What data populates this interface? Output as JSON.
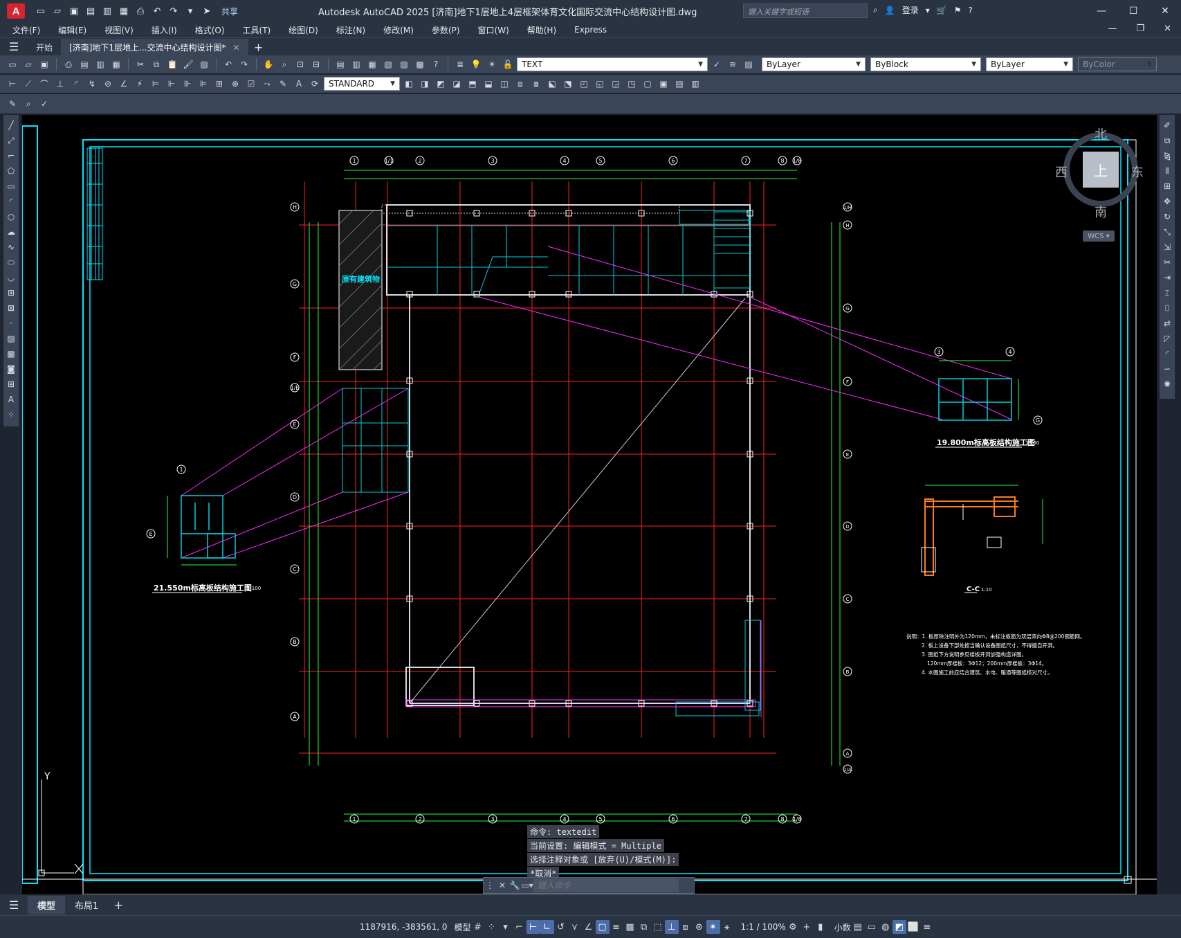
{
  "titlebar": {
    "app_letter": "A",
    "share_label": "共享",
    "title": "Autodesk AutoCAD 2025    [济南]地下1层地上4层框架体育文化国际交流中心结构设计图.dwg",
    "search_placeholder": "键入关键字或短语",
    "login_label": "登录"
  },
  "menu": {
    "items": [
      "文件(F)",
      "编辑(E)",
      "视图(V)",
      "插入(I)",
      "格式(O)",
      "工具(T)",
      "绘图(D)",
      "标注(N)",
      "修改(M)",
      "参数(P)",
      "窗口(W)",
      "帮助(H)",
      "Express"
    ]
  },
  "tabs": {
    "start_label": "开始",
    "doc_label": "[济南]地下1层地上...交流中心结构设计图*"
  },
  "toolbar": {
    "text_style": "TEXT",
    "dim_style": "STANDARD",
    "layer": "ByLayer",
    "linetype": "ByBlock",
    "lineweight": "ByLayer",
    "color": "ByColor"
  },
  "viewcube": {
    "top": "上",
    "north": "北",
    "south": "南",
    "east": "东",
    "west": "西",
    "wcs": "WCS"
  },
  "drawing": {
    "existing_building": "原有建筑物",
    "plan_title_1980": "19.800m标高板结构施工图",
    "plan_title_2155": "21.550m标高板结构施工图",
    "section_title": "C-C",
    "scale_1_100": "1:100",
    "scale_1_10": "1:10",
    "cols_top": [
      "1",
      "1/1",
      "2",
      "3",
      "4",
      "5",
      "6",
      "7",
      "8",
      "1/8"
    ],
    "rows_left": [
      "H",
      "G",
      "F",
      "1/E",
      "E",
      "D",
      "C",
      "B",
      "A"
    ],
    "rows_right": [
      "1/H",
      "H",
      "G",
      "F",
      "E",
      "D",
      "C",
      "B",
      "A",
      "1/A"
    ],
    "notes": [
      "说明：1. 板厚除注明外为120mm，未标注板筋为双层双向Φ8@200钢筋网。",
      "2. 板上设备下部处按当确认设备图纸尺寸，不得擅自开洞。",
      "3. 图纸下方说明参见楼板开洞加强构造详图。",
      "120mm厚楼板：3Φ12；200mm厚楼板：3Φ14。",
      "4. 本图施工前应结合建筑、水电、暖通等图纸核对尺寸。"
    ],
    "axis_y": "Y"
  },
  "command": {
    "history": [
      "命令:  textedit",
      "当前设置: 编辑模式 = Multiple",
      "选择注释对象或 [放弃(U)/模式(M)]:",
      "*取消*"
    ],
    "placeholder": "键入命令"
  },
  "layouts": {
    "model": "模型",
    "layout1": "布局1"
  },
  "status": {
    "coords": "1187916, -383561, 0",
    "model": "模型",
    "scale": "1:1 / 100%",
    "units": "小数"
  }
}
